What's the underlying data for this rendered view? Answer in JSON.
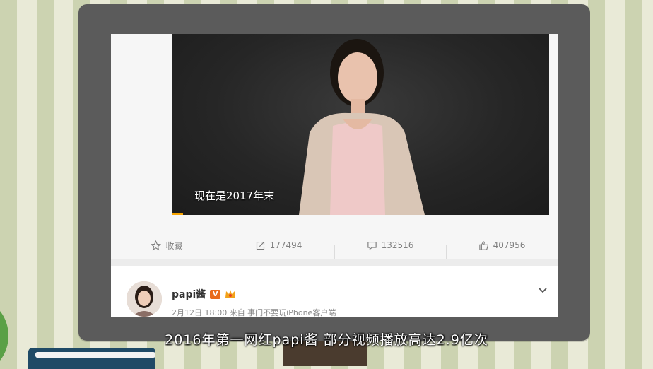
{
  "video": {
    "subtitle": "现在是2017年末",
    "progress_fraction": 0.03
  },
  "actions": [
    {
      "icon": "star-icon",
      "label": "收藏"
    },
    {
      "icon": "share-icon",
      "label": "177494"
    },
    {
      "icon": "comment-icon",
      "label": "132516"
    },
    {
      "icon": "thumbs-up-icon",
      "label": "407956"
    }
  ],
  "post": {
    "username": "papi酱",
    "verified_badge": "V",
    "meta": "2月12日 18:00 来自 事门不要玩iPhone客户端"
  },
  "caption": "2016年第一网红papi酱 部分视频播放高达2.9亿次",
  "colors": {
    "accent_orange": "#e96c1c",
    "progress": "#f7a400",
    "monitor_bezel": "#5b5b5b"
  }
}
